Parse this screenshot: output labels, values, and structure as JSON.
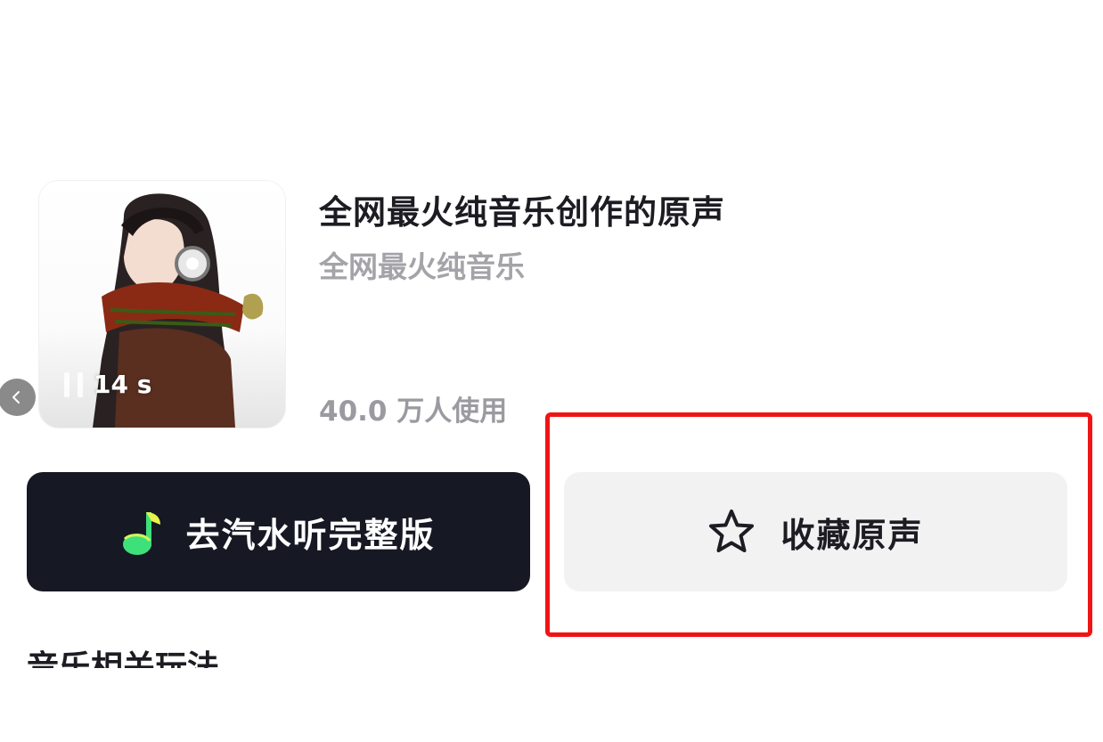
{
  "track": {
    "title": "全网最火纯音乐创作的原声",
    "artist": "全网最火纯音乐",
    "usage_count": "40.0 万人使用",
    "duration": "14 s"
  },
  "actions": {
    "listen_full_label": "去汽水听完整版",
    "favorite_label": "收藏原声"
  },
  "section": {
    "title": "音乐相关玩法"
  },
  "icons": {
    "back": "chevron-left-icon",
    "pause": "pause-icon",
    "music_app": "music-note-icon",
    "favorite": "star-outline-icon"
  },
  "colors": {
    "dark_button": "#161823",
    "light_button": "#f2f2f3",
    "highlight": "#f01414",
    "note_green": "#3ee07a"
  }
}
